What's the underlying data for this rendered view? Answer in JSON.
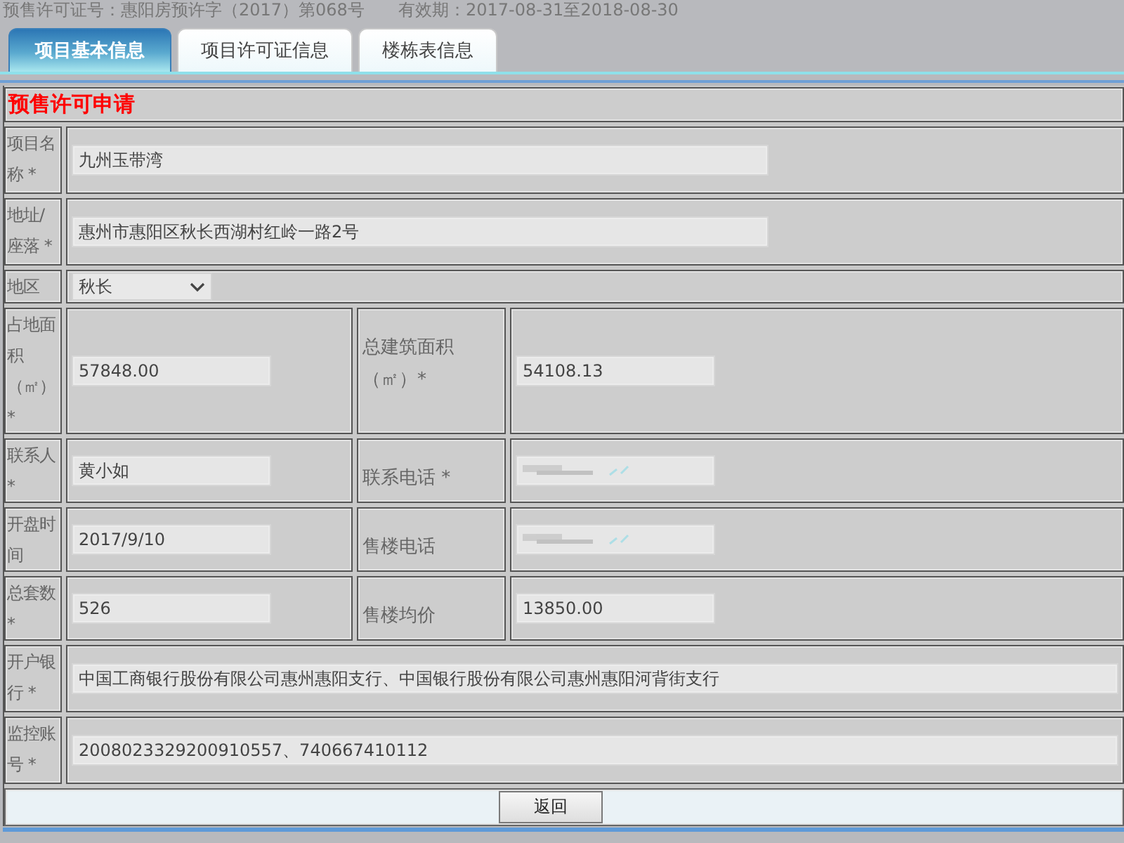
{
  "header": {
    "permit": "预售许可证号：惠阳房预许字（2017）第068号",
    "validity": "有效期：2017-08-31至2018-08-30"
  },
  "tabs": [
    {
      "label": "项目基本信息",
      "selected": true
    },
    {
      "label": "项目许可证信息",
      "selected": false
    },
    {
      "label": "楼栋表信息",
      "selected": false
    }
  ],
  "section_title": "预售许可申请",
  "rows": [
    {
      "kind": "single",
      "label": "项目名称 *",
      "field": {
        "kind": "text",
        "value": "九州玉带湾"
      }
    },
    {
      "kind": "single",
      "label": "地址/座落 *",
      "field": {
        "kind": "text",
        "value": "惠州市惠阳区秋长西湖村红岭一路2号"
      }
    },
    {
      "kind": "single",
      "label": "地区",
      "field": {
        "kind": "select",
        "value": "秋长"
      }
    },
    {
      "kind": "pair",
      "cells": [
        {
          "label": "占地面积（㎡）*",
          "field": {
            "kind": "text",
            "value": "57848.00"
          }
        },
        {
          "label": "总建筑面积（㎡）*",
          "field": {
            "kind": "text",
            "value": "54108.13"
          }
        }
      ]
    },
    {
      "kind": "pair",
      "cells": [
        {
          "label": "联系人 *",
          "field": {
            "kind": "text",
            "value": "黄小如"
          }
        },
        {
          "label": "联系电话 *",
          "field": {
            "kind": "masked"
          }
        }
      ]
    },
    {
      "kind": "pair",
      "cells": [
        {
          "label": "开盘时间",
          "field": {
            "kind": "text",
            "value": "2017/9/10"
          }
        },
        {
          "label": "售楼电话",
          "field": {
            "kind": "masked"
          }
        }
      ]
    },
    {
      "kind": "pair",
      "cells": [
        {
          "label": "总套数 *",
          "field": {
            "kind": "text",
            "value": "526"
          }
        },
        {
          "label": "售楼均价",
          "field": {
            "kind": "text",
            "value": "13850.00"
          }
        }
      ]
    },
    {
      "kind": "single",
      "label": "开户银行 *",
      "field": {
        "kind": "fulltext",
        "value": "中国工商银行股份有限公司惠州惠阳支行、中国银行股份有限公司惠州惠阳河背街支行"
      }
    },
    {
      "kind": "single",
      "label": "监控账号 *",
      "field": {
        "kind": "fulltext",
        "value": "2008023329200910557、740667410112"
      }
    }
  ],
  "button": "返回"
}
